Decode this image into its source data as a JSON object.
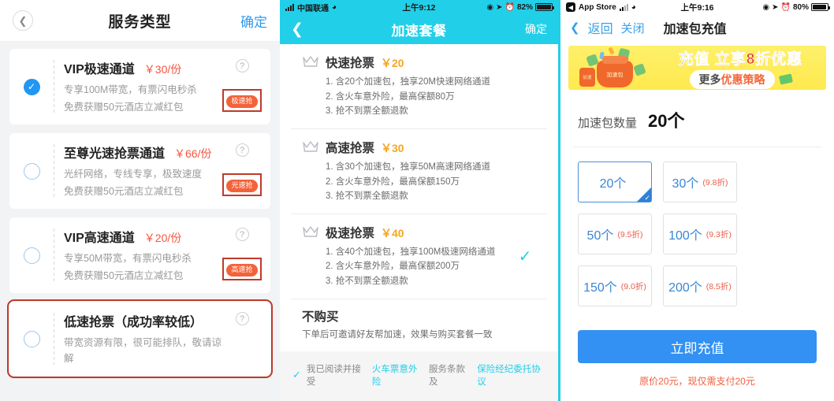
{
  "panel1": {
    "header": {
      "back_icon": "chevron-left-icon",
      "title": "服务类型",
      "confirm": "确定"
    },
    "services": [
      {
        "name": "VIP极速通道",
        "price": "￥30/份",
        "sub1": "专享100M带宽，有票闪电秒杀",
        "sub2": "免费获赠50元酒店立减红包",
        "badge": "极速抢",
        "help": "?",
        "selected": true,
        "highlighted": false,
        "badge_highlighted": true
      },
      {
        "name": "至尊光速抢票通道",
        "price": "￥66/份",
        "sub1": "光纤网络，专线专享，极致速度",
        "sub2": "免费获赠50元酒店立减红包",
        "badge": "光速抢",
        "help": "?",
        "selected": false,
        "highlighted": false,
        "badge_highlighted": true
      },
      {
        "name": "VIP高速通道",
        "price": "￥20/份",
        "sub1": "专享50M带宽，有票闪电秒杀",
        "sub2": "免费获赠50元酒店立减红包",
        "badge": "高速抢",
        "help": "?",
        "selected": false,
        "highlighted": false,
        "badge_highlighted": true
      },
      {
        "name": "低速抢票（成功率较低）",
        "price": "",
        "sub1": "带宽资源有限，很可能排队，敬请谅解",
        "sub2": "",
        "badge": "",
        "help": "?",
        "selected": false,
        "highlighted": true,
        "badge_highlighted": false
      }
    ]
  },
  "panel2": {
    "statusbar": {
      "carrier": "中国联通",
      "time": "上午9:12",
      "battery": "82%",
      "wifi_icon": "wifi-icon",
      "signal_icon": "signal-bars-icon",
      "location_icon": "location-arrow-icon",
      "alarm_icon": "alarm-clock-icon",
      "rotation_icon": "rotation-lock-icon"
    },
    "header": {
      "back_icon": "chevron-left-icon",
      "title": "加速套餐",
      "confirm": "确定"
    },
    "packages": [
      {
        "title": "快速抢票",
        "price": "￥20",
        "lines": [
          "1. 含20个加速包，独享20M快速网络通道",
          "2. 含火车意外险，最高保额80万",
          "3. 抢不到票全额退款"
        ],
        "selected": false
      },
      {
        "title": "高速抢票",
        "price": "￥30",
        "lines": [
          "1. 含30个加速包，独享50M高速网络通道",
          "2. 含火车意外险，最高保额150万",
          "3. 抢不到票全额退款"
        ],
        "selected": false
      },
      {
        "title": "极速抢票",
        "price": "￥40",
        "lines": [
          "1. 含40个加速包，独享100M极速网络通道",
          "2. 含火车意外险，最高保额200万",
          "3. 抢不到票全额退款"
        ],
        "selected": true
      }
    ],
    "no_buy": {
      "title": "不购买",
      "sub": "下单后可邀请好友帮加速，效果与购买套餐一致"
    },
    "agreement": {
      "prefix": "我已阅读并接受",
      "link1": "火车票意外险",
      "middle": "服务条款及",
      "link2": "保险经纪委托协议",
      "checked": true
    }
  },
  "panel3": {
    "statusbar": {
      "app_back": "App Store",
      "time": "上午9:16",
      "battery": "80%"
    },
    "header": {
      "back": "返回",
      "close": "关闭",
      "title": "加速包充值"
    },
    "banner": {
      "word1": "充值",
      "word2": "立享8折优惠",
      "pill_a": "更多",
      "pill_b": "优惠策略"
    },
    "quantity": {
      "label": "加速包数量",
      "value": "20个"
    },
    "options": [
      {
        "count": "20个",
        "discount": "",
        "selected": true
      },
      {
        "count": "30个",
        "discount": "(9.8折)",
        "selected": false
      },
      {
        "count": "50个",
        "discount": "(9.5折)",
        "selected": false
      },
      {
        "count": "100个",
        "discount": "(9.3折)",
        "selected": false
      },
      {
        "count": "150个",
        "discount": "(9.0折)",
        "selected": false
      },
      {
        "count": "200个",
        "discount": "(8.5折)",
        "selected": false
      }
    ],
    "cta": "立即充值",
    "cta_note": "原价20元，现仅需支付20元"
  },
  "colors": {
    "cyan": "#22cfe8",
    "blue": "#3291f2",
    "orange_badge": "#f4623a",
    "red_outline": "#c0392b",
    "price_red": "#f5553d",
    "price_orange": "#f5a623",
    "banner_yellow": "#ffe94f"
  }
}
